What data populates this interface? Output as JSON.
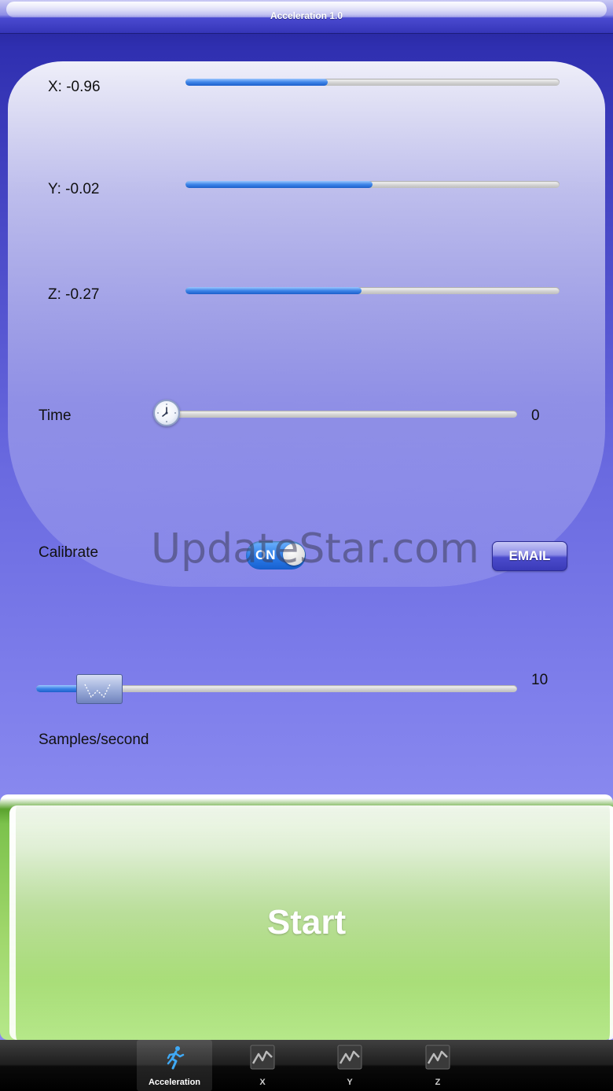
{
  "app": {
    "title": "Acceleration 1.0"
  },
  "readouts": [
    {
      "label": "X: -0.96",
      "fraction": 0.38
    },
    {
      "label": "Y: -0.02",
      "fraction": 0.5
    },
    {
      "label": "Z: -0.27",
      "fraction": 0.47
    }
  ],
  "time": {
    "label": "Time",
    "value": "0",
    "fraction": 0.0
  },
  "calibrate": {
    "label": "Calibrate",
    "toggle_label": "ON",
    "state": "on"
  },
  "email": {
    "label": "EMAIL"
  },
  "samples": {
    "label": "Samples/second",
    "value": "10",
    "fraction": 0.1
  },
  "start": {
    "label": "Start"
  },
  "watermark": "UpdateStar.com",
  "tabs": [
    {
      "label": "Acceleration",
      "icon": "runner-icon",
      "selected": true
    },
    {
      "label": "X",
      "icon": "graph-icon",
      "selected": false
    },
    {
      "label": "Y",
      "icon": "graph-icon",
      "selected": false
    },
    {
      "label": "Z",
      "icon": "graph-icon",
      "selected": false
    }
  ],
  "colors": {
    "accent_blue": "#2b7be8",
    "start_green": "#7cc24c",
    "nav_indigo": "#3535b8"
  }
}
